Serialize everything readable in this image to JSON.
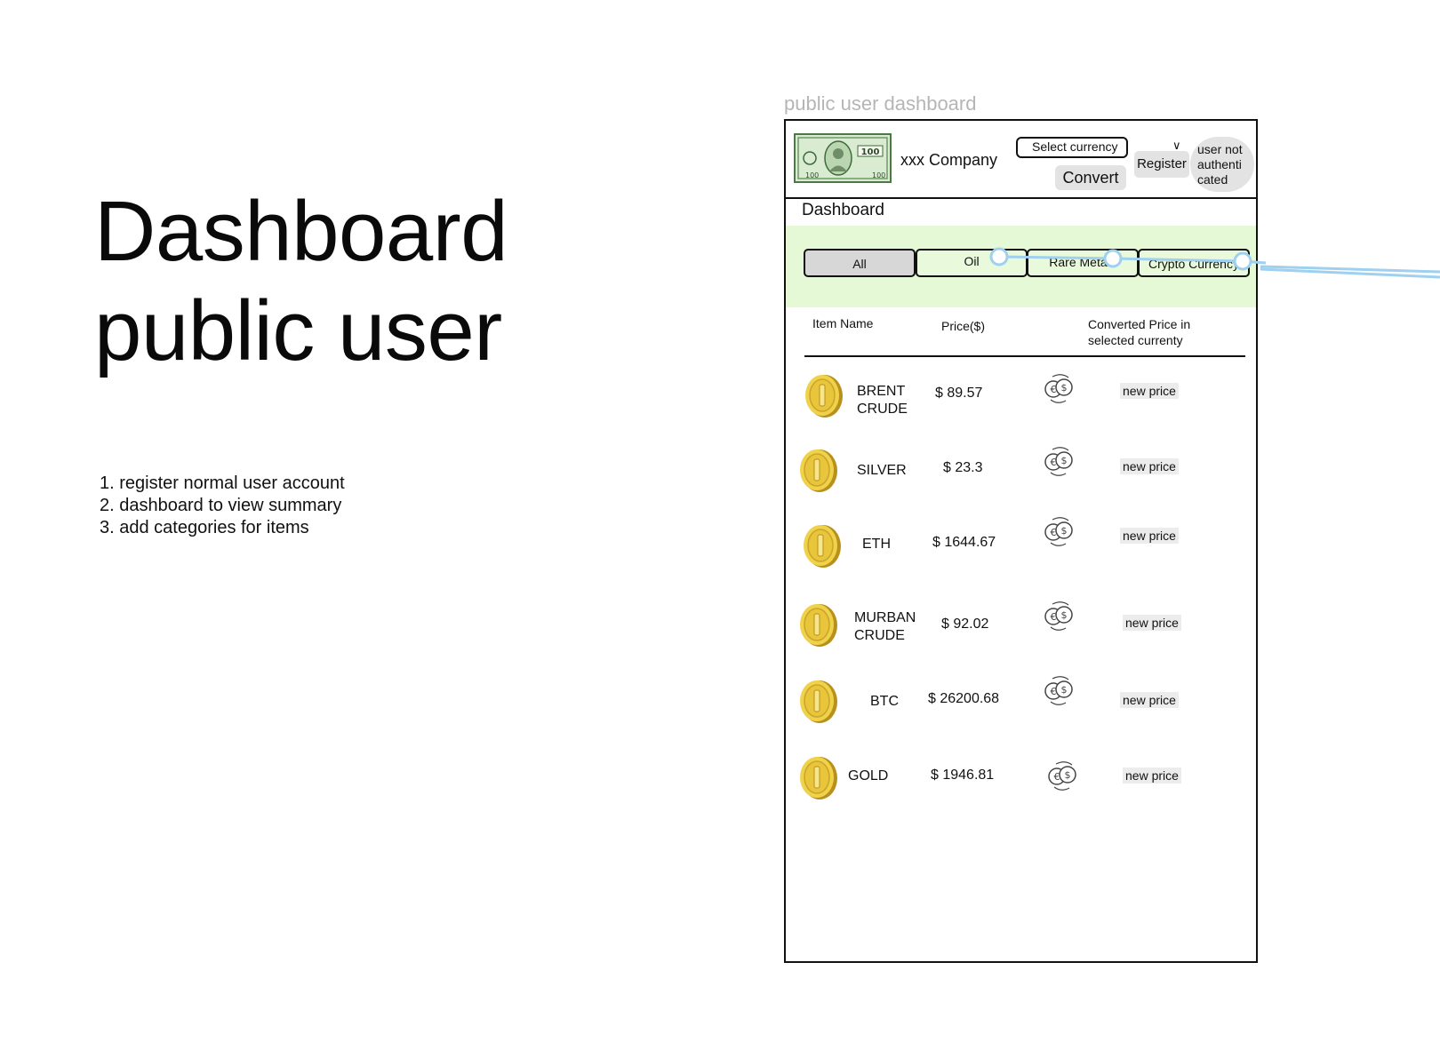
{
  "left": {
    "title_line1": "Dashboard",
    "title_line2": "public user",
    "notes": [
      "1. register normal user account",
      "2. dashboard to view summary",
      "3. add categories for items"
    ]
  },
  "frame": {
    "label": "public user dashboard",
    "header": {
      "company_name": "xxx Company",
      "currency_select_placeholder": "Select currency",
      "convert_label": "Convert",
      "register_label": "Register",
      "user_status": "user not authenti cated"
    },
    "dashboard_title": "Dashboard",
    "tabs": [
      {
        "label": "All",
        "selected": true
      },
      {
        "label": "Oil",
        "selected": false
      },
      {
        "label": "Rare Metals",
        "selected": false
      },
      {
        "label": "Crypto Currency",
        "selected": false
      }
    ],
    "columns": {
      "name": "Item Name",
      "price": "Price($)",
      "converted": "Converted Price in selected currenty"
    },
    "rows": [
      {
        "name": "BRENT CRUDE",
        "price": "$ 89.57",
        "converted": "new price"
      },
      {
        "name": "SILVER",
        "price": "$ 23.3",
        "converted": "new price"
      },
      {
        "name": "ETH",
        "price": "$ 1644.67",
        "converted": "new price"
      },
      {
        "name": "MURBAN CRUDE",
        "price": "$ 92.02",
        "converted": "new price"
      },
      {
        "name": "BTC",
        "price": "$ 26200.68",
        "converted": "new price"
      },
      {
        "name": "GOLD",
        "price": "$ 1946.81",
        "converted": "new price"
      }
    ]
  },
  "colors": {
    "filter_band": "#e6f9d6",
    "selected_tab": "#d7d7d7",
    "button_gray": "#e3e3e3",
    "connector_blue": "#9fd0ef",
    "coin_gold": "#e8c53a"
  },
  "icons": {
    "logo": "dollar-bill-icon",
    "coin": "gold-coin-icon",
    "convert": "currency-exchange-icon",
    "chevron": "chevron-down-icon"
  }
}
